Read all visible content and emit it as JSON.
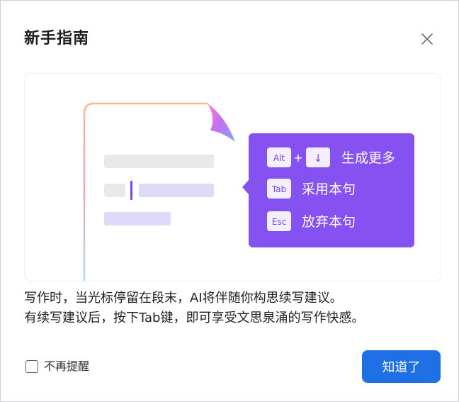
{
  "dialog": {
    "title": "新手指南",
    "close_icon": "close-icon"
  },
  "illustration": {
    "shortcuts": [
      {
        "keys": [
          "Alt",
          "↓"
        ],
        "label": "生成更多"
      },
      {
        "keys": [
          "Tab"
        ],
        "label": "采用本句"
      },
      {
        "keys": [
          "Esc"
        ],
        "label": "放弃本句"
      }
    ],
    "plus_sign": "+",
    "colors": {
      "popup": "#8551f0",
      "key_bg": "#f3efff",
      "key_text": "#7a45ea",
      "placeholder_gray": "#e9e9ec",
      "placeholder_purple": "#ddd9f7",
      "cursor": "#7a45ea"
    }
  },
  "description": {
    "line1": "写作时，当光标停留在段末，AI将伴随你构思续写建议。",
    "line2": "有续写建议后，按下Tab键，即可享受文思泉涌的写作快感。"
  },
  "footer": {
    "checkbox_label": "不再提醒",
    "checkbox_checked": false,
    "confirm_label": "知道了",
    "confirm_color": "#1f6fe5"
  }
}
